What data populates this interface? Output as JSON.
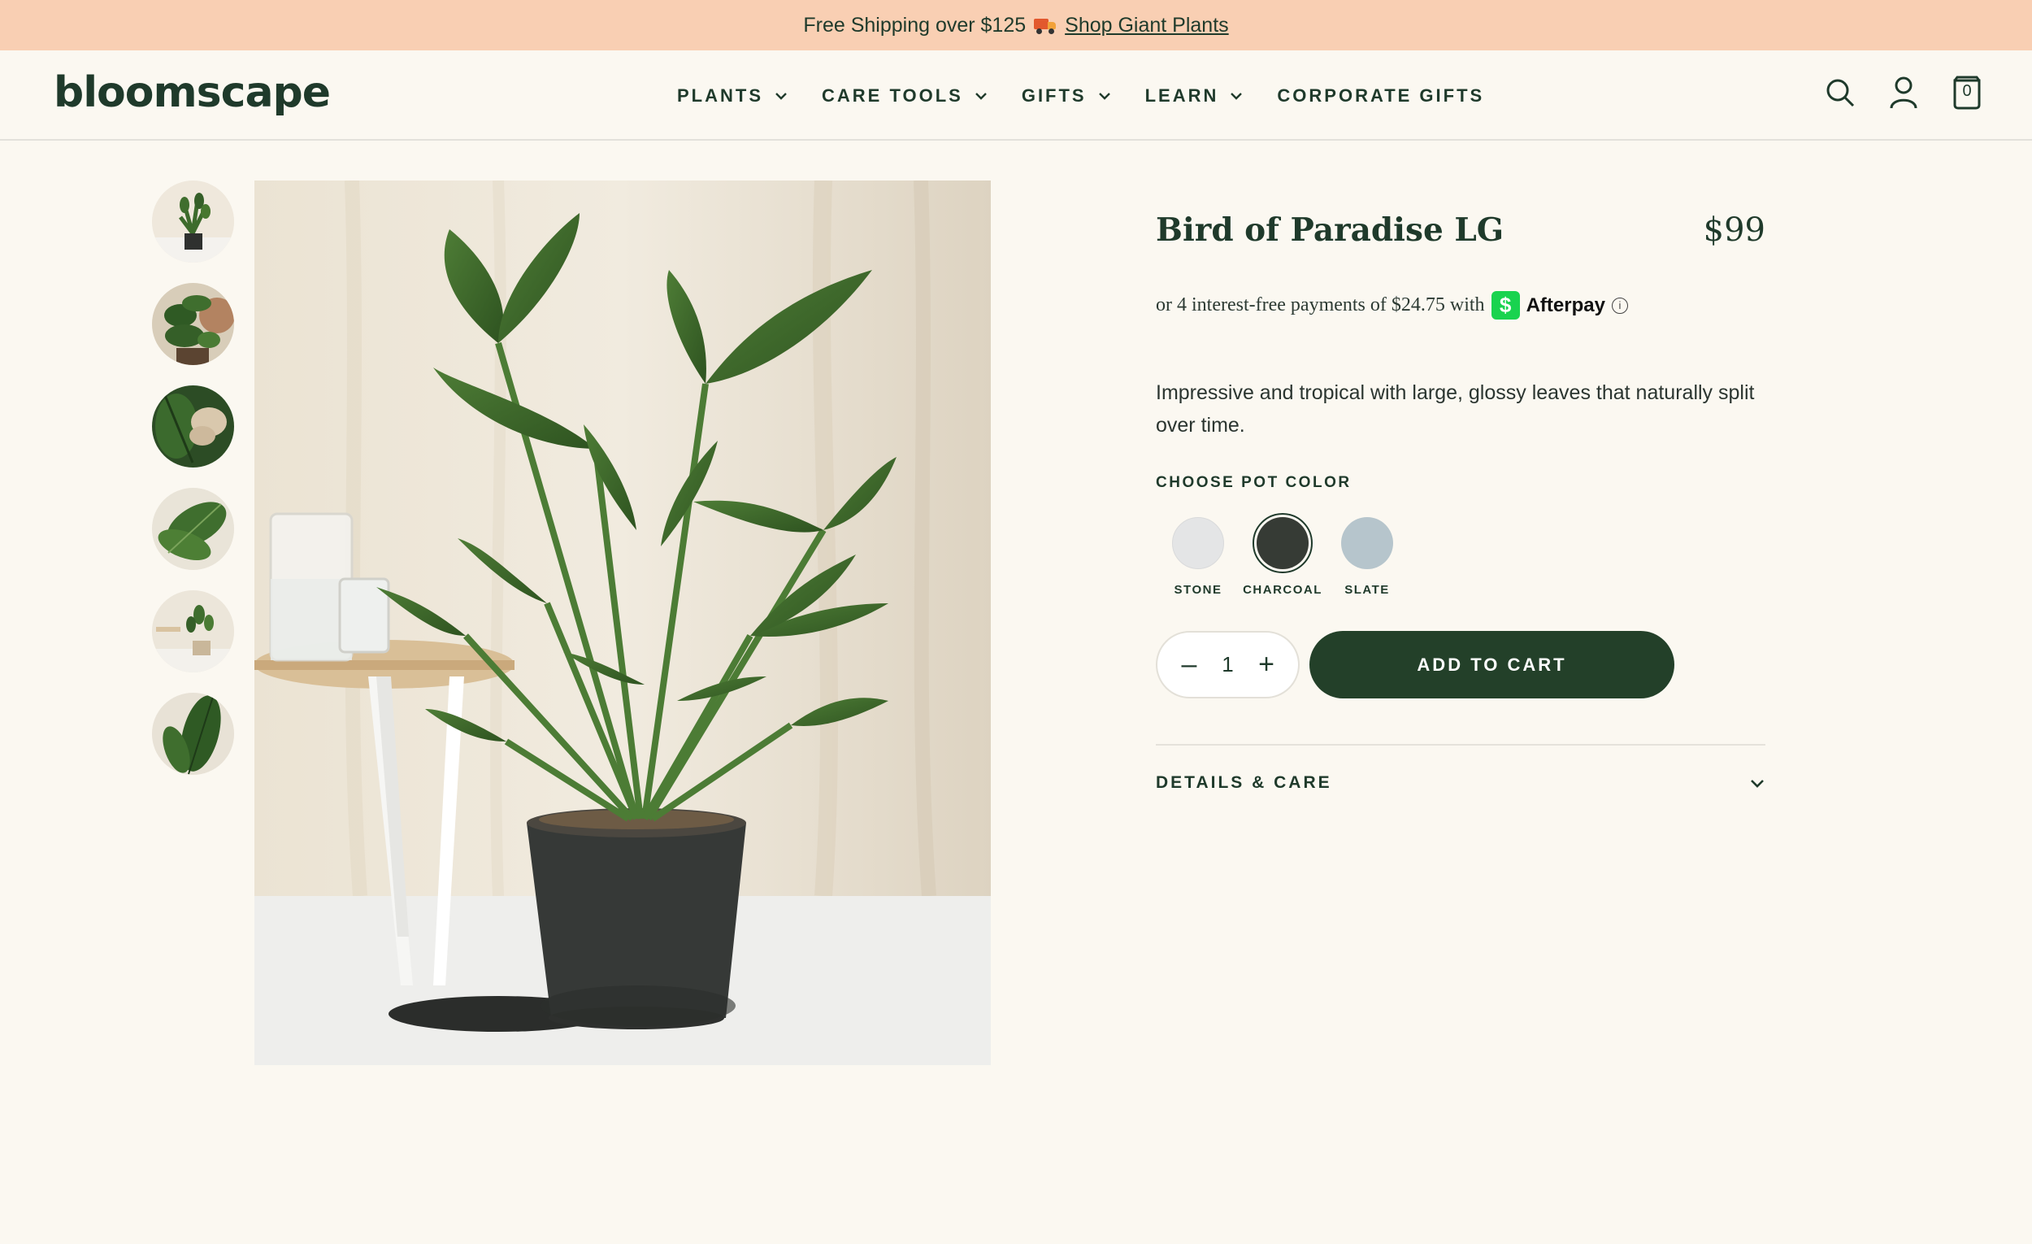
{
  "promo": {
    "text": "Free Shipping over $125",
    "link": "Shop Giant Plants",
    "icon": "truck-emoji"
  },
  "header": {
    "logo": "bloomscape",
    "nav": [
      {
        "label": "PLANTS",
        "dropdown": true
      },
      {
        "label": "CARE TOOLS",
        "dropdown": true
      },
      {
        "label": "GIFTS",
        "dropdown": true
      },
      {
        "label": "LEARN",
        "dropdown": true
      },
      {
        "label": "CORPORATE GIFTS",
        "dropdown": false
      }
    ],
    "icons": [
      "search-icon",
      "account-icon",
      "cart-icon"
    ],
    "cart_count": "0"
  },
  "gallery": {
    "thumbnail_count": 6
  },
  "product": {
    "title": "Bird of Paradise LG",
    "price": "$99",
    "afterpay_text": "or 4 interest-free payments of $24.75 with",
    "afterpay_brand": "Afterpay",
    "afterpay_logo_glyph": "$",
    "info_glyph": "i",
    "description": "Impressive and tropical with large, glossy leaves that naturally split over time.",
    "pot_color_label": "CHOOSE POT COLOR",
    "pot_colors": [
      {
        "label": "STONE",
        "color": "#e4e5e6",
        "selected": false
      },
      {
        "label": "CHARCOAL",
        "color": "#363b35",
        "selected": true
      },
      {
        "label": "SLATE",
        "color": "#b6c5cc",
        "selected": false
      }
    ],
    "quantity": "1",
    "qty_minus": "–",
    "qty_plus": "+",
    "add_to_cart": "ADD TO CART",
    "details_label": "DETAILS & CARE"
  },
  "colors": {
    "promo_bg": "#f9cfb3",
    "brand_green": "#234029",
    "page_bg": "#fbf8f1"
  }
}
